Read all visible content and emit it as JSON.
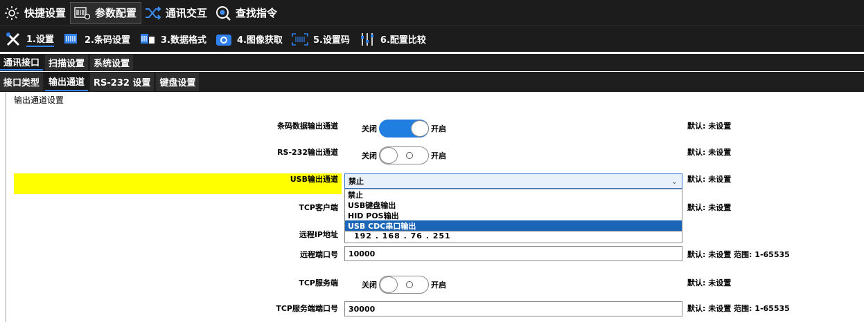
{
  "top_tabs": [
    {
      "label": "快捷设置",
      "icon": "gear-icon",
      "active": false
    },
    {
      "label": "参数配置",
      "icon": "barcode-config-icon",
      "active": true
    },
    {
      "label": "通讯交互",
      "icon": "shuffle-icon",
      "active": false
    },
    {
      "label": "查找指令",
      "icon": "search-icon",
      "active": false
    }
  ],
  "sub_tabs": [
    {
      "label": "1.设置",
      "icon": "tools-icon",
      "active": true
    },
    {
      "label": "2.条码设置",
      "icon": "barcode-icon",
      "active": false
    },
    {
      "label": "3.数据格式",
      "icon": "data-format-icon",
      "active": false
    },
    {
      "label": "4.图像获取",
      "icon": "camera-icon",
      "active": false
    },
    {
      "label": "5.设置码",
      "icon": "scan-code-icon",
      "active": false
    },
    {
      "label": "6.配置比较",
      "icon": "sliders-icon",
      "active": false
    }
  ],
  "tabs_level3": [
    {
      "label": "通讯接口",
      "active": true
    },
    {
      "label": "扫描设置",
      "active": false
    },
    {
      "label": "系统设置",
      "active": false
    }
  ],
  "tabs_level4": [
    {
      "label": "接口类型",
      "active": false
    },
    {
      "label": "输出通道",
      "active": true
    },
    {
      "label": "RS-232 设置",
      "active": false
    },
    {
      "label": "键盘设置",
      "active": false
    }
  ],
  "section_title": "输出通道设置",
  "toggle_off_label": "关闭",
  "toggle_on_label": "开启",
  "rows": {
    "barcode_output": {
      "label": "条码数据输出通道",
      "state": "on",
      "default": "默认: 未设置"
    },
    "rs232_output": {
      "label": "RS-232输出通道",
      "state": "off",
      "default": "默认: 未设置"
    },
    "usb_output": {
      "label": "USB输出通道",
      "value": "禁止",
      "default": "默认: 未设置"
    },
    "tcp_client": {
      "label": "TCP客户端",
      "default": "默认: 未设置"
    },
    "remote_ip": {
      "label": "远程IP地址",
      "value": "192  .  168  .  76  .  251"
    },
    "remote_port": {
      "label": "远程端口号",
      "value": "10000",
      "default": "默认: 未设置  范围: 1-65535"
    },
    "tcp_server": {
      "label": "TCP服务端",
      "state": "off",
      "default": "默认: 未设置"
    },
    "tcp_server_port": {
      "label": "TCP服务端端口号",
      "value": "30000",
      "default": "默认: 未设置  范围: 1-65535"
    }
  },
  "usb_options": [
    "禁止",
    "USB键盘输出",
    "HID POS输出",
    "USB CDC串口输出"
  ],
  "usb_options_selected": "USB CDC串口输出",
  "colors": {
    "accent": "#1f7ee0",
    "highlight": "#ffff00",
    "selected_option": "#1b65b6",
    "toolbar_bg": "#1c1c1c"
  }
}
